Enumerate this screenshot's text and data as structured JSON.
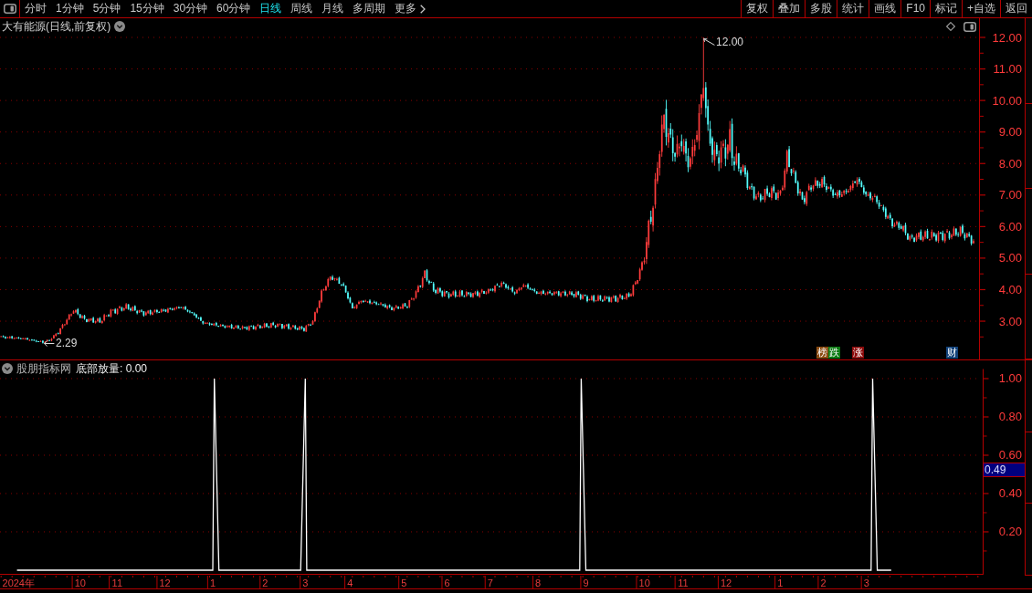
{
  "toolbar": {
    "tabs": [
      {
        "label": "分时",
        "kind": "period",
        "selected": false
      },
      {
        "label": "1分钟",
        "kind": "period",
        "selected": false
      },
      {
        "label": "5分钟",
        "kind": "period",
        "selected": false
      },
      {
        "label": "15分钟",
        "kind": "period",
        "selected": false
      },
      {
        "label": "30分钟",
        "kind": "period",
        "selected": false
      },
      {
        "label": "60分钟",
        "kind": "period",
        "selected": false
      },
      {
        "label": "日线",
        "kind": "period",
        "selected": true
      },
      {
        "label": "周线",
        "kind": "period",
        "selected": false
      },
      {
        "label": "月线",
        "kind": "period",
        "selected": false
      },
      {
        "label": "多周期",
        "kind": "period",
        "selected": false
      },
      {
        "label": "更多",
        "kind": "more",
        "selected": false
      }
    ],
    "buttons": [
      "复权",
      "叠加",
      "多股",
      "统计",
      "画线",
      "F10",
      "标记",
      "+自选",
      "返回"
    ]
  },
  "price_panel": {
    "title": "大有能源(日线,前复权)",
    "price_labels": [
      "12.00",
      "11.00",
      "10.00",
      "9.00",
      "8.00",
      "7.00",
      "6.00",
      "5.00",
      "4.00",
      "3.00"
    ],
    "high_label": "12.00",
    "low_label": "2.29",
    "event_tags": [
      {
        "label": "榜",
        "color": "#8a4a10"
      },
      {
        "label": "跌",
        "color": "#0b7a12"
      },
      {
        "label": "涨",
        "color": "#8c0a0a"
      },
      {
        "label": "财",
        "color": "#12427a"
      }
    ]
  },
  "indicator_panel": {
    "source": "股朋指标网",
    "readout": "底部放量: 0.00",
    "cursor_value": "0.49",
    "chart_data": {
      "type": "line",
      "x": [
        "2024-08-28",
        "2025-01-02",
        "2025-01-03",
        "2025-01-06",
        "2025-02-28",
        "2025-03-03",
        "2025-03-04",
        "2025-08-28",
        "2025-08-29",
        "2025-09-01",
        "2026-03-05",
        "2026-03-06",
        "2026-03-09",
        "2026-03-18"
      ],
      "values": [
        0,
        0,
        1,
        0,
        0,
        1,
        0,
        0,
        1,
        0,
        0,
        1,
        0,
        0
      ],
      "xlim": [
        "2024-08-17",
        "2026-05-14"
      ],
      "ylim": [
        -0.024,
        1.05
      ],
      "grid": true,
      "yticks": [
        {
          "value": 1,
          "label": "1.00"
        },
        {
          "value": 0.8,
          "label": "0.80"
        },
        {
          "value": 0.6,
          "label": "0.60"
        },
        {
          "value": 0.4,
          "label": "0.40"
        },
        {
          "value": 0.2,
          "label": "0.20"
        }
      ],
      "xticks": [
        {
          "value": "2024-08-29",
          "label": "2024年"
        },
        {
          "value": "2024-10-08",
          "label": "10"
        },
        {
          "value": "2024-11-01",
          "label": "11"
        },
        {
          "value": "2024-12-02",
          "label": "12"
        },
        {
          "value": "2025-01-02",
          "label": "1"
        },
        {
          "value": "2025-02-05",
          "label": "2"
        },
        {
          "value": "2025-03-03",
          "label": "3"
        },
        {
          "value": "2025-04-01",
          "label": "4"
        },
        {
          "value": "2025-05-06",
          "label": "5"
        },
        {
          "value": "2025-06-03",
          "label": "6"
        },
        {
          "value": "2025-07-01",
          "label": "7"
        },
        {
          "value": "2025-08-01",
          "label": "8"
        },
        {
          "value": "2025-09-01",
          "label": "9"
        },
        {
          "value": "2025-10-09",
          "label": "10"
        },
        {
          "value": "2025-11-03",
          "label": "11"
        },
        {
          "value": "2025-12-01",
          "label": "12"
        },
        {
          "value": "2026-01-05",
          "label": "1"
        },
        {
          "value": "2026-02-02",
          "label": "2"
        },
        {
          "value": "2026-03-02",
          "label": "3"
        }
      ]
    }
  }
}
